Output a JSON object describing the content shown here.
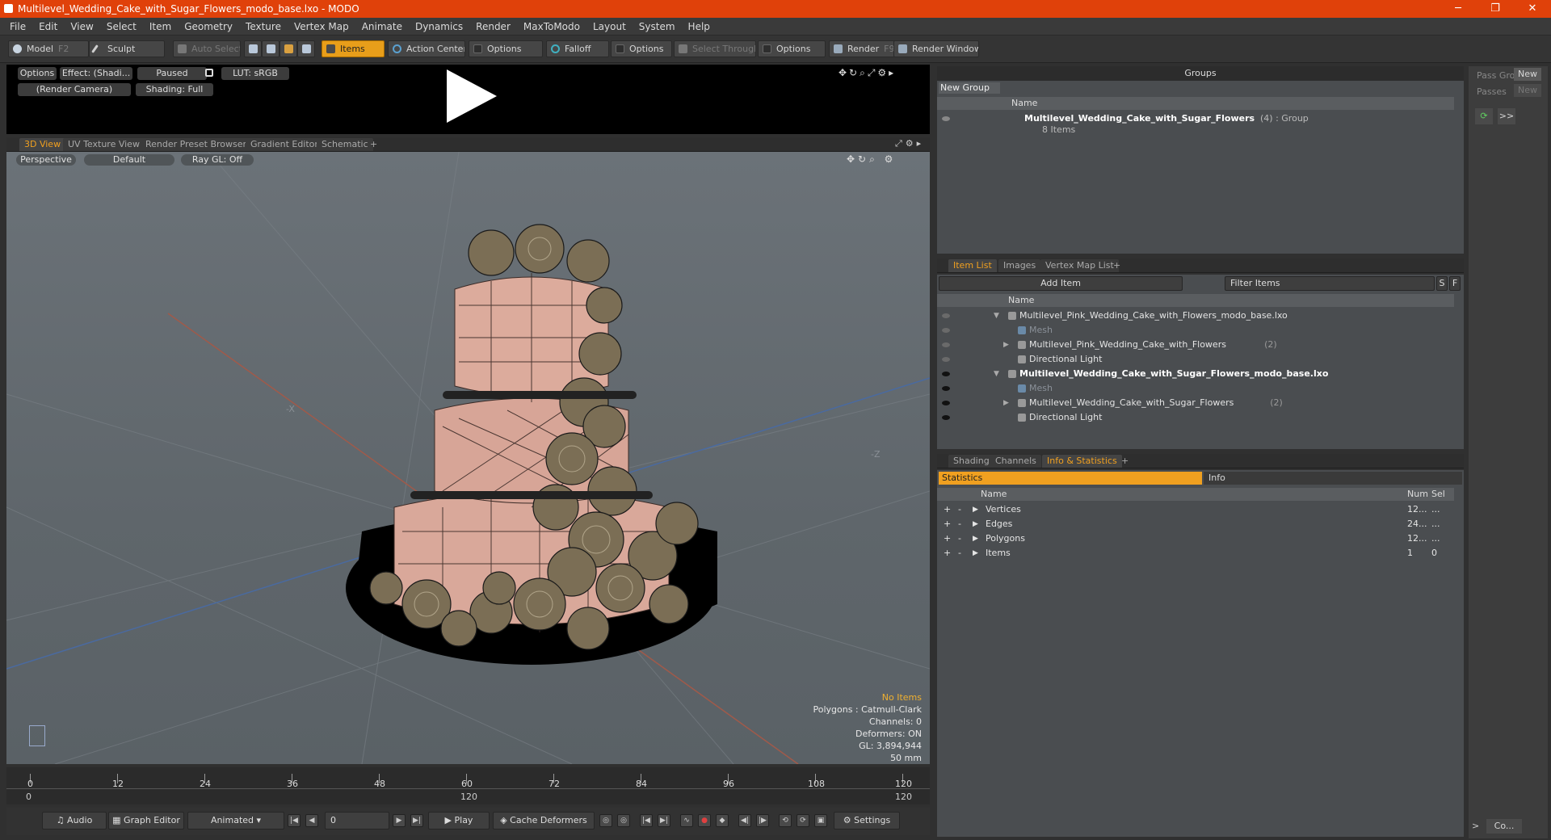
{
  "window": {
    "title": "Multilevel_Wedding_Cake_with_Sugar_Flowers_modo_base.lxo - MODO",
    "minimize": "─",
    "maximize": "❐",
    "close": "✕"
  },
  "menu": [
    "File",
    "Edit",
    "View",
    "Select",
    "Item",
    "Geometry",
    "Texture",
    "Vertex Map",
    "Animate",
    "Dynamics",
    "Render",
    "MaxToModo",
    "Layout",
    "System",
    "Help"
  ],
  "toolbar": {
    "model": "Model",
    "model_key": "F2",
    "sculpt": "Sculpt",
    "auto_select": "Auto Select",
    "items": "Items",
    "action_center": "Action Center",
    "options1": "Options",
    "falloff": "Falloff",
    "options2": "Options",
    "select_through": "Select Through",
    "options3": "Options",
    "render": "Render",
    "render_key": "F9",
    "render_window": "Render Window"
  },
  "preview": {
    "options": "Options",
    "effect": "Effect: (Shadi...",
    "paused": "Paused",
    "lut": "LUT: sRGB",
    "camera": "(Render Camera)",
    "shading": "Shading: Full"
  },
  "view_tabs": [
    "3D View",
    "UV Texture View",
    "Render Preset Browser",
    "Gradient Editor",
    "Schematic",
    "+"
  ],
  "viewport": {
    "perspective": "Perspective",
    "default": "Default",
    "raygl": "Ray GL: Off",
    "axis_x": "-X",
    "axis_z": "-Z",
    "stats": {
      "no_items": "No Items",
      "polygons": "Polygons : Catmull-Clark",
      "channels": "Channels: 0",
      "deformers": "Deformers: ON",
      "gl": "GL: 3,894,944",
      "focal": "50 mm"
    }
  },
  "timeline": {
    "ticks": [
      "0",
      "12",
      "24",
      "36",
      "48",
      "60",
      "72",
      "84",
      "96",
      "108",
      "120"
    ],
    "lower_left": "0",
    "lower_mid": "120",
    "lower_right": "120"
  },
  "bottom": {
    "audio": "Audio",
    "graph_editor": "Graph Editor",
    "animated": "Animated",
    "frame": "0",
    "play": "Play",
    "cache_deformers": "Cache Deformers",
    "settings": "Settings"
  },
  "groups": {
    "title": "Groups",
    "new_group": "New Group",
    "col_name": "Name",
    "group_name": "Multilevel_Wedding_Cake_with_Sugar_Flowers",
    "group_suffix": "(4) : Group",
    "group_items": "8 Items"
  },
  "passes": {
    "pass_gro": "Pass Gro",
    "passes": "Passes",
    "new1": "New",
    "new2": "New",
    "more": ">>",
    "co": "Co..."
  },
  "item_list": {
    "tabs": [
      "Item List",
      "Images",
      "Vertex Map List",
      "+"
    ],
    "add_item": "Add Item",
    "filter": "Filter Items",
    "s": "S",
    "f": "F",
    "col_name": "Name",
    "rows": [
      {
        "label": "Multilevel_Pink_Wedding_Cake_with_Flowers_modo_base.lxo",
        "suffix": "",
        "level": 0,
        "bold": false,
        "dim": false,
        "eye": false
      },
      {
        "label": "Mesh",
        "suffix": "",
        "level": 1,
        "bold": false,
        "dim": true,
        "eye": false
      },
      {
        "label": "Multilevel_Pink_Wedding_Cake_with_Flowers",
        "suffix": "(2)",
        "level": 1,
        "bold": false,
        "dim": false,
        "eye": false
      },
      {
        "label": "Directional Light",
        "suffix": "",
        "level": 1,
        "bold": false,
        "dim": false,
        "eye": false
      },
      {
        "label": "Multilevel_Wedding_Cake_with_Sugar_Flowers_modo_base.lxo",
        "suffix": "",
        "level": 0,
        "bold": true,
        "dim": false,
        "eye": true
      },
      {
        "label": "Mesh",
        "suffix": "",
        "level": 1,
        "bold": false,
        "dim": true,
        "eye": true
      },
      {
        "label": "Multilevel_Wedding_Cake_with_Sugar_Flowers",
        "suffix": "(2)",
        "level": 1,
        "bold": false,
        "dim": false,
        "eye": true
      },
      {
        "label": "Directional Light",
        "suffix": "",
        "level": 1,
        "bold": false,
        "dim": false,
        "eye": true
      }
    ]
  },
  "info_panel": {
    "tabs": [
      "Shading",
      "Channels",
      "Info & Statistics",
      "+"
    ],
    "statistics": "Statistics",
    "info": "Info",
    "col_name": "Name",
    "col_num": "Num",
    "col_sel": "Sel",
    "rows": [
      {
        "name": "Vertices",
        "num": "12...",
        "sel": "..."
      },
      {
        "name": "Edges",
        "num": "24...",
        "sel": "..."
      },
      {
        "name": "Polygons",
        "num": "12...",
        "sel": "..."
      },
      {
        "name": "Items",
        "num": "1",
        "sel": "0"
      }
    ]
  }
}
